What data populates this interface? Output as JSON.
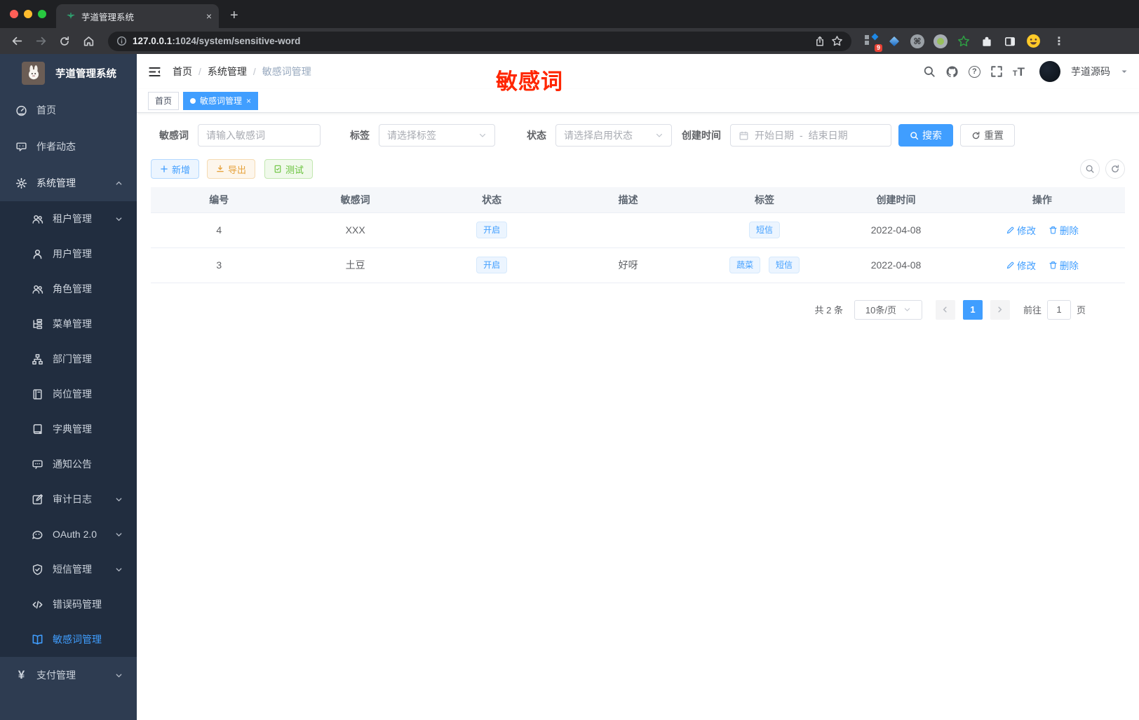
{
  "browser": {
    "tab_title": "芋道管理系统",
    "tab_close": "×",
    "new_tab": "+",
    "url_host": "127.0.0.1",
    "url_rest": ":1024/system/sensitive-word",
    "extension_badge": "9",
    "more_menu": "⋮"
  },
  "sidebar": {
    "title": "芋道管理系统",
    "items": [
      {
        "label": "首页",
        "icon": "dashboard-icon"
      },
      {
        "label": "作者动态",
        "icon": "chat-icon"
      },
      {
        "label": "系统管理",
        "icon": "gear-icon"
      }
    ],
    "submenu": [
      {
        "label": "租户管理",
        "icon": "users-icon"
      },
      {
        "label": "用户管理",
        "icon": "user-icon"
      },
      {
        "label": "角色管理",
        "icon": "users-icon"
      },
      {
        "label": "菜单管理",
        "icon": "menu-tree-icon"
      },
      {
        "label": "部门管理",
        "icon": "org-icon"
      },
      {
        "label": "岗位管理",
        "icon": "badge-icon"
      },
      {
        "label": "字典管理",
        "icon": "book-icon"
      },
      {
        "label": "通知公告",
        "icon": "comment-icon"
      },
      {
        "label": "审计日志",
        "icon": "edit-icon"
      },
      {
        "label": "OAuth 2.0",
        "icon": "robot-icon"
      },
      {
        "label": "短信管理",
        "icon": "shield-icon"
      },
      {
        "label": "错误码管理",
        "icon": "code-icon"
      },
      {
        "label": "敏感词管理",
        "icon": "open-book-icon"
      }
    ],
    "bottom": [
      {
        "label": "支付管理",
        "icon": "yen-icon"
      }
    ]
  },
  "navbar": {
    "breadcrumb": [
      "首页",
      "系统管理",
      "敏感词管理"
    ],
    "separator": "/",
    "username": "芋道源码"
  },
  "tags": {
    "home": "首页",
    "active": "敏感词管理",
    "close": "×"
  },
  "annotation": {
    "text": "敏感词",
    "color": "#ff2600"
  },
  "filter": {
    "keyword_label": "敏感词",
    "keyword_placeholder": "请输入敏感词",
    "tag_label": "标签",
    "tag_placeholder": "请选择标签",
    "status_label": "状态",
    "status_placeholder": "请选择启用状态",
    "time_label": "创建时间",
    "start_placeholder": "开始日期",
    "range_separator": "-",
    "end_placeholder": "结束日期",
    "search_label": "搜索",
    "reset_label": "重置"
  },
  "toolbar": {
    "add_label": "新增",
    "export_label": "导出",
    "test_label": "测试"
  },
  "table": {
    "headers": [
      "编号",
      "敏感词",
      "状态",
      "描述",
      "标签",
      "创建时间",
      "操作"
    ],
    "rows": [
      {
        "id": "4",
        "word": "XXX",
        "status": "开启",
        "desc": "",
        "tags": [
          "短信"
        ],
        "created": "2022-04-08"
      },
      {
        "id": "3",
        "word": "土豆",
        "status": "开启",
        "desc": "好呀",
        "tags": [
          "蔬菜",
          "短信"
        ],
        "created": "2022-04-08"
      }
    ],
    "edit_label": "修改",
    "delete_label": "删除"
  },
  "pagination": {
    "total": "共 2 条",
    "page_size": "10条/页",
    "page": "1",
    "goto_label": "前往",
    "goto_value": "1",
    "unit_label": "页"
  },
  "colors": {
    "accent": "#409eff",
    "warning": "#e6a23c",
    "success": "#67c23a",
    "annotation_red": "#ff2600"
  }
}
